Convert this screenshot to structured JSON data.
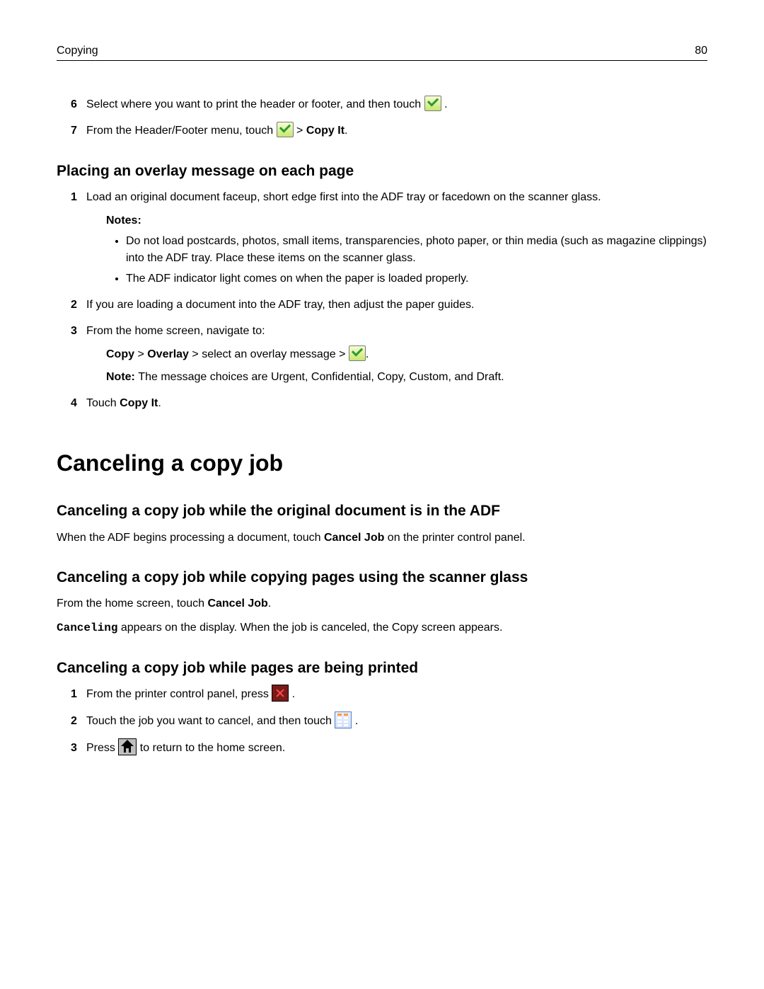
{
  "header": {
    "section": "Copying",
    "page": "80"
  },
  "steps_top": {
    "s6": {
      "num": "6",
      "text_a": "Select where you want to print the header or footer, and then touch ",
      "text_b": "."
    },
    "s7": {
      "num": "7",
      "text_a": "From the Header/Footer menu, touch ",
      "text_b": " > ",
      "bold": "Copy It",
      "text_c": "."
    }
  },
  "overlay": {
    "heading": "Placing an overlay message on each page",
    "s1": {
      "num": "1",
      "text": "Load an original document faceup, short edge first into the ADF tray or facedown on the scanner glass."
    },
    "notes_label": "Notes:",
    "bullet1": "Do not load postcards, photos, small items, transparencies, photo paper, or thin media (such as magazine clippings) into the ADF tray. Place these items on the scanner glass.",
    "bullet2": "The ADF indicator light comes on when the paper is loaded properly.",
    "s2": {
      "num": "2",
      "text": "If you are loading a document into the ADF tray, then adjust the paper guides."
    },
    "s3": {
      "num": "3",
      "text": "From the home screen, navigate to:"
    },
    "path": {
      "b1": "Copy",
      "sep1": " > ",
      "b2": "Overlay",
      "sep2": " > select an overlay message > ",
      "end": "."
    },
    "note_line": {
      "label": "Note: ",
      "text": "The message choices are Urgent, Confidential, Copy, Custom, and Draft."
    },
    "s4": {
      "num": "4",
      "text_a": "Touch ",
      "bold": "Copy It",
      "text_b": "."
    }
  },
  "cancel": {
    "heading": "Canceling a copy job",
    "adf": {
      "heading": "Canceling a copy job while the original document is in the ADF",
      "text_a": "When the ADF begins processing a document, touch ",
      "bold": "Cancel Job",
      "text_b": " on the printer control panel."
    },
    "glass": {
      "heading": "Canceling a copy job while copying pages using the scanner glass",
      "line1_a": "From the home screen, touch ",
      "line1_bold": "Cancel Job",
      "line1_b": ".",
      "line2_mono": "Canceling",
      "line2_rest": " appears on the display. When the job is canceled, the Copy screen appears."
    },
    "printing": {
      "heading": "Canceling a copy job while pages are being printed",
      "s1": {
        "num": "1",
        "text_a": "From the printer control panel, press ",
        "text_b": "."
      },
      "s2": {
        "num": "2",
        "text_a": "Touch the job you want to cancel, and then touch ",
        "text_b": "."
      },
      "s3": {
        "num": "3",
        "text_a": "Press ",
        "text_b": " to return to the home screen."
      }
    }
  }
}
